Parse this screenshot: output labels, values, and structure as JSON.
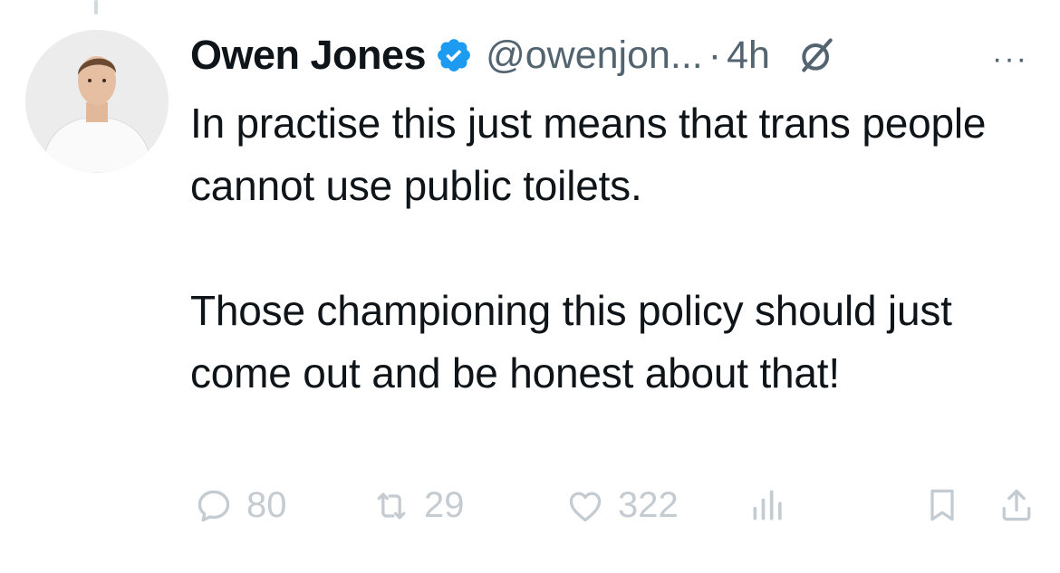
{
  "tweet": {
    "author_name": "Owen Jones",
    "handle": "@owenjon...",
    "separator": "·",
    "time": "4h",
    "more_label": "···",
    "paragraphs": [
      "In practise this just means that trans people cannot use public toilets.",
      "Those championing this policy should just come out and be honest about that!"
    ]
  },
  "actions": {
    "replies": "80",
    "reposts": "29",
    "likes": "322"
  },
  "icons": {
    "verified": "verified-badge-icon",
    "grok": "grok-icon",
    "more": "more-icon",
    "reply": "reply-icon",
    "repost": "repost-icon",
    "like": "heart-icon",
    "views": "views-icon",
    "bookmark": "bookmark-icon",
    "share": "share-icon"
  },
  "colors": {
    "verified": "#1d9bf0",
    "text": "#0f1419",
    "secondary": "#536471",
    "action_gray": "#c4ccd2"
  }
}
